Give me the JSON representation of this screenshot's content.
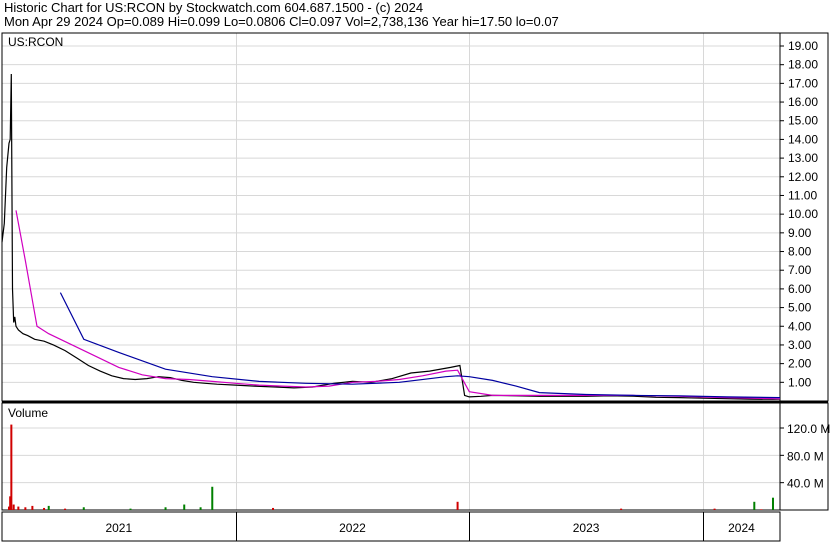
{
  "header": {
    "line1": "Historic Chart for US:RCON by Stockwatch.com 604.687.1500 - (c) 2024",
    "line2": "Mon Apr 29 2024   Op=0.089   Hi=0.099   Lo=0.0806   Cl=0.097   Vol=2,738,136   Year hi=17.50   lo=0.07"
  },
  "chart_data": [
    {
      "type": "line",
      "panel": "price",
      "title": "US:RCON",
      "ylim": [
        0,
        19.5
      ],
      "yticks": [
        "1.00",
        "2.00",
        "3.00",
        "4.00",
        "5.00",
        "6.00",
        "7.00",
        "8.00",
        "9.00",
        "10.00",
        "11.00",
        "12.00",
        "13.00",
        "14.00",
        "15.00",
        "16.00",
        "17.00",
        "18.00",
        "19.00"
      ],
      "x_date_labels": [
        "2021",
        "2022",
        "2023",
        "2024"
      ],
      "grid": true,
      "series": [
        {
          "color": "#000000",
          "x": [
            2021.0,
            2021.01,
            2021.02,
            2021.03,
            2021.035,
            2021.04,
            2021.045,
            2021.05,
            2021.055,
            2021.06,
            2021.07,
            2021.09,
            2021.11,
            2021.14,
            2021.18,
            2021.22,
            2021.27,
            2021.32,
            2021.37,
            2021.42,
            2021.47,
            2021.52,
            2021.57,
            2021.62,
            2021.67,
            2021.72,
            2021.77,
            2021.82,
            2021.87,
            2021.92,
            2022.0,
            2022.08,
            2022.17,
            2022.25,
            2022.33,
            2022.42,
            2022.5,
            2022.58,
            2022.67,
            2022.75,
            2022.83,
            2022.92,
            2022.96,
            2022.98,
            2023.0,
            2023.05,
            2023.1,
            2023.2,
            2023.3,
            2023.4,
            2023.5,
            2023.6,
            2023.7,
            2023.8,
            2023.9,
            2024.0,
            2024.1,
            2024.2,
            2024.3,
            2024.33
          ],
          "values": [
            8.5,
            9.5,
            12.5,
            13.8,
            14.0,
            17.5,
            6.0,
            4.2,
            4.5,
            4.0,
            3.8,
            3.6,
            3.5,
            3.3,
            3.2,
            3.0,
            2.7,
            2.3,
            1.9,
            1.6,
            1.35,
            1.2,
            1.15,
            1.2,
            1.3,
            1.25,
            1.1,
            1.0,
            0.95,
            0.9,
            0.85,
            0.8,
            0.75,
            0.7,
            0.75,
            0.95,
            1.05,
            1.0,
            1.2,
            1.5,
            1.6,
            1.8,
            1.9,
            0.3,
            0.22,
            0.25,
            0.3,
            0.28,
            0.25,
            0.25,
            0.25,
            0.28,
            0.26,
            0.2,
            0.18,
            0.15,
            0.13,
            0.1,
            0.09,
            0.097
          ]
        },
        {
          "color": "#d000c0",
          "x": [
            2021.06,
            2021.1,
            2021.15,
            2021.2,
            2021.3,
            2021.4,
            2021.5,
            2021.6,
            2021.7,
            2021.8,
            2021.9,
            2022.0,
            2022.1,
            2022.2,
            2022.3,
            2022.4,
            2022.5,
            2022.6,
            2022.7,
            2022.8,
            2022.9,
            2022.95,
            2023.0,
            2023.1,
            2023.3,
            2023.5,
            2023.7,
            2023.9,
            2024.1,
            2024.33
          ],
          "values": [
            10.2,
            7.5,
            4.0,
            3.6,
            3.0,
            2.4,
            1.8,
            1.4,
            1.2,
            1.15,
            1.05,
            0.95,
            0.85,
            0.8,
            0.75,
            0.8,
            1.0,
            1.05,
            1.15,
            1.35,
            1.6,
            1.65,
            0.5,
            0.3,
            0.3,
            0.3,
            0.3,
            0.25,
            0.18,
            0.12
          ]
        },
        {
          "color": "#0000a0",
          "x": [
            2021.25,
            2021.35,
            2021.5,
            2021.7,
            2021.9,
            2022.1,
            2022.3,
            2022.5,
            2022.7,
            2022.9,
            2022.95,
            2023.0,
            2023.1,
            2023.2,
            2023.3,
            2023.5,
            2023.7,
            2023.9,
            2024.1,
            2024.33
          ],
          "values": [
            5.8,
            3.3,
            2.6,
            1.7,
            1.3,
            1.05,
            0.95,
            0.9,
            1.0,
            1.3,
            1.35,
            1.3,
            1.1,
            0.8,
            0.45,
            0.35,
            0.3,
            0.28,
            0.22,
            0.18
          ]
        }
      ]
    },
    {
      "type": "bar",
      "panel": "volume",
      "title": "Volume",
      "ylim": [
        0,
        140
      ],
      "yticks": [
        "40.0 M",
        "80.0 M",
        "120.0 M"
      ],
      "series": [
        {
          "color": "#d00000",
          "x": [
            2021.03,
            2021.035,
            2021.04,
            2021.05,
            2021.07,
            2021.1,
            2021.13,
            2021.18,
            2021.27,
            2022.16,
            2022.95,
            2023.65,
            2024.05,
            2024.25
          ],
          "values": [
            5,
            20,
            125,
            8,
            5,
            4,
            6,
            3,
            2,
            3,
            12,
            2,
            2,
            1
          ]
        },
        {
          "color": "#008000",
          "x": [
            2021.2,
            2021.35,
            2021.55,
            2021.7,
            2021.78,
            2021.85,
            2021.9,
            2024.22,
            2024.3
          ],
          "values": [
            6,
            4,
            2,
            4,
            8,
            4,
            34,
            12,
            18
          ]
        }
      ]
    }
  ]
}
